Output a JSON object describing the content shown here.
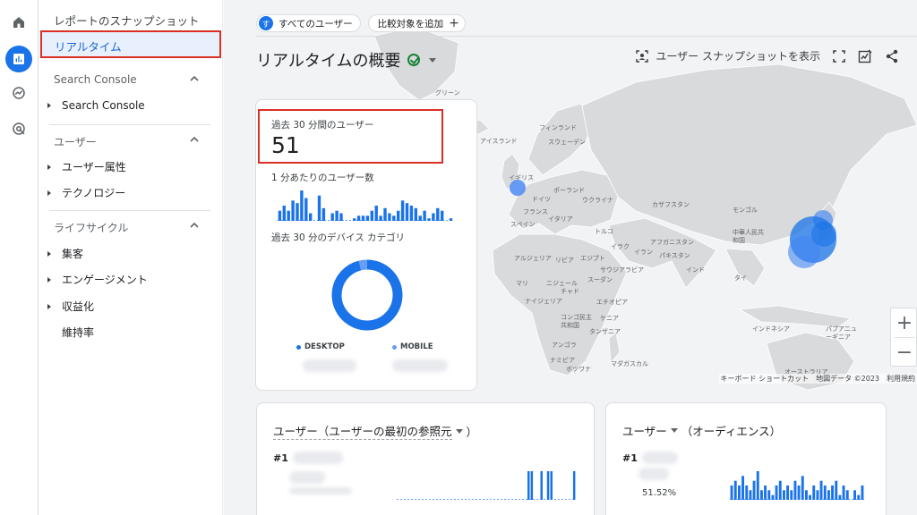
{
  "sidebar": {
    "snapshot_link": "レポートのスナップショット",
    "realtime_link": "リアルタイム",
    "sections": [
      {
        "title": "Search Console",
        "items": [
          {
            "label": "Search Console",
            "expandable": true
          }
        ]
      },
      {
        "title": "ユーザー",
        "items": [
          {
            "label": "ユーザー属性",
            "expandable": true
          },
          {
            "label": "テクノロジー",
            "expandable": true
          }
        ]
      },
      {
        "title": "ライフサイクル",
        "items": [
          {
            "label": "集客",
            "expandable": true
          },
          {
            "label": "エンゲージメント",
            "expandable": true
          },
          {
            "label": "収益化",
            "expandable": true
          },
          {
            "label": "維持率",
            "expandable": false
          }
        ]
      }
    ]
  },
  "header": {
    "audience_chip_avatar": "す",
    "audience_chip_label": "すべてのユーザー",
    "add_comparison_label": "比較対象を追加",
    "title": "リアルタイムの概要",
    "snapshot_button": "ユーザー スナップショットを表示"
  },
  "realtime_card": {
    "users_label": "過去 30 分間のユーザー",
    "users_value": "51",
    "per_minute_label": "1 分あたりのユーザー数",
    "per_minute_values": [
      4,
      6,
      4,
      8,
      7,
      12,
      9,
      3,
      0,
      10,
      5,
      0,
      3,
      4,
      3,
      0,
      0,
      1,
      2,
      2,
      2,
      4,
      6,
      2,
      5,
      3,
      2,
      4,
      8,
      7,
      6,
      5,
      2,
      4,
      1,
      3,
      5,
      4,
      0,
      1
    ],
    "device_label": "過去 30 分のデバイス カテゴリ",
    "device_donut": {
      "desktop_fraction": 0.96,
      "mobile_fraction": 0.04
    },
    "legend": [
      {
        "label": "DESKTOP",
        "color": "#1a73e8"
      },
      {
        "label": "MOBILE",
        "color": "#669df6"
      }
    ]
  },
  "map": {
    "labels": [
      "グリーン",
      "フィンランド",
      "スウェーデン",
      "イギリス",
      "アイスランド",
      "ポーランド",
      "ウクライナ",
      "ドイツ",
      "フランス",
      "イタリア",
      "スペイン",
      "カザフスタン",
      "モンゴル",
      "トルコ",
      "イラク",
      "イラン",
      "中華人民共和国",
      "アフガニスタン",
      "パキスタン",
      "インド",
      "タイ",
      "アルジェリア",
      "リビア",
      "エジプト",
      "サウジアラビア",
      "マリ",
      "ニジェール",
      "チャド",
      "エチオピア",
      "ナイジェリア",
      "コンゴ民主共和国",
      "ケニア",
      "タンザニア",
      "アンゴラ",
      "ナミビア",
      "ボツワナ",
      "マダガスカル",
      "インドネシア",
      "パプアニューギニア",
      "オーストラリア",
      "スーダン"
    ],
    "zoom_in": "+",
    "zoom_out": "−",
    "attribution": [
      "キーボード ショートカット",
      "地図データ ©2023",
      "利用規約"
    ]
  },
  "card_users_source": {
    "title_part1": "ユーザー（ユーザーの最初の参照元",
    "title_part2": "）",
    "rank": "#1",
    "bar_values": [
      0,
      0,
      0,
      0,
      0,
      0,
      0,
      0,
      0,
      0,
      0,
      0,
      0,
      0,
      0,
      0,
      0,
      0,
      0,
      0,
      0,
      0,
      0,
      0,
      0,
      0,
      0,
      0,
      0,
      0,
      0,
      0,
      0,
      0,
      0,
      0,
      0,
      0,
      0,
      0,
      1,
      1,
      0,
      0,
      1,
      0,
      1,
      1,
      0,
      0,
      0,
      0,
      0,
      0,
      1
    ]
  },
  "card_users_audience": {
    "title_part1": "ユーザー",
    "title_part2": "（オーディエンス）",
    "rank": "#1",
    "percent": "51.52%",
    "bar_values": [
      3,
      4,
      3,
      5,
      3,
      2,
      4,
      6,
      2,
      3,
      2,
      1,
      3,
      4,
      2,
      3,
      2,
      4,
      3,
      5,
      2,
      1,
      3,
      2,
      4,
      3,
      2,
      3,
      4,
      1,
      3,
      2,
      0,
      2,
      1,
      3
    ]
  },
  "colors": {
    "accent": "#1a73e8",
    "highlight": "#d93025",
    "map_land": "#d9dadc",
    "map_water": "#f1f3f4"
  }
}
